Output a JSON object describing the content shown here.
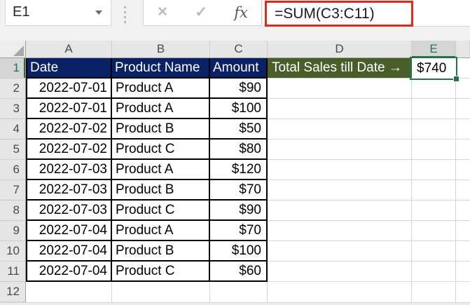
{
  "name_box": {
    "value": "E1"
  },
  "formula_bar": {
    "formula": "=SUM(C3:C11)",
    "fx_label": "fx",
    "cancel_glyph": "✕",
    "confirm_glyph": "✓",
    "highlight_color": "#e42a1d"
  },
  "sheet": {
    "column_headers": {
      "a": "A",
      "b": "B",
      "c": "C",
      "d": "D",
      "e": "E"
    },
    "selected_column": "E",
    "selected_cell": "E1",
    "header_row": {
      "n": "1",
      "a": "Date",
      "b": "Product Name",
      "c": "Amount",
      "d": "Total Sales till Date →",
      "e": "$740"
    },
    "rows": [
      {
        "n": "2",
        "date": "2022-07-01",
        "product": "Product A",
        "amount": "$90"
      },
      {
        "n": "3",
        "date": "2022-07-01",
        "product": "Product A",
        "amount": "$100"
      },
      {
        "n": "4",
        "date": "2022-07-02",
        "product": "Product B",
        "amount": "$50"
      },
      {
        "n": "5",
        "date": "2022-07-02",
        "product": "Product C",
        "amount": "$80"
      },
      {
        "n": "6",
        "date": "2022-07-03",
        "product": "Product A",
        "amount": "$120"
      },
      {
        "n": "7",
        "date": "2022-07-03",
        "product": "Product B",
        "amount": "$70"
      },
      {
        "n": "8",
        "date": "2022-07-03",
        "product": "Product C",
        "amount": "$90"
      },
      {
        "n": "9",
        "date": "2022-07-04",
        "product": "Product A",
        "amount": "$70"
      },
      {
        "n": "10",
        "date": "2022-07-04",
        "product": "Product B",
        "amount": "$100"
      },
      {
        "n": "11",
        "date": "2022-07-04",
        "product": "Product C",
        "amount": "$60"
      }
    ],
    "empty_row_number": "12"
  },
  "colors": {
    "header_fill_navy": "#0b2166",
    "header_fill_olive": "#4a5e2a",
    "selection_green": "#217346",
    "annotation_red": "#e42a1d"
  }
}
